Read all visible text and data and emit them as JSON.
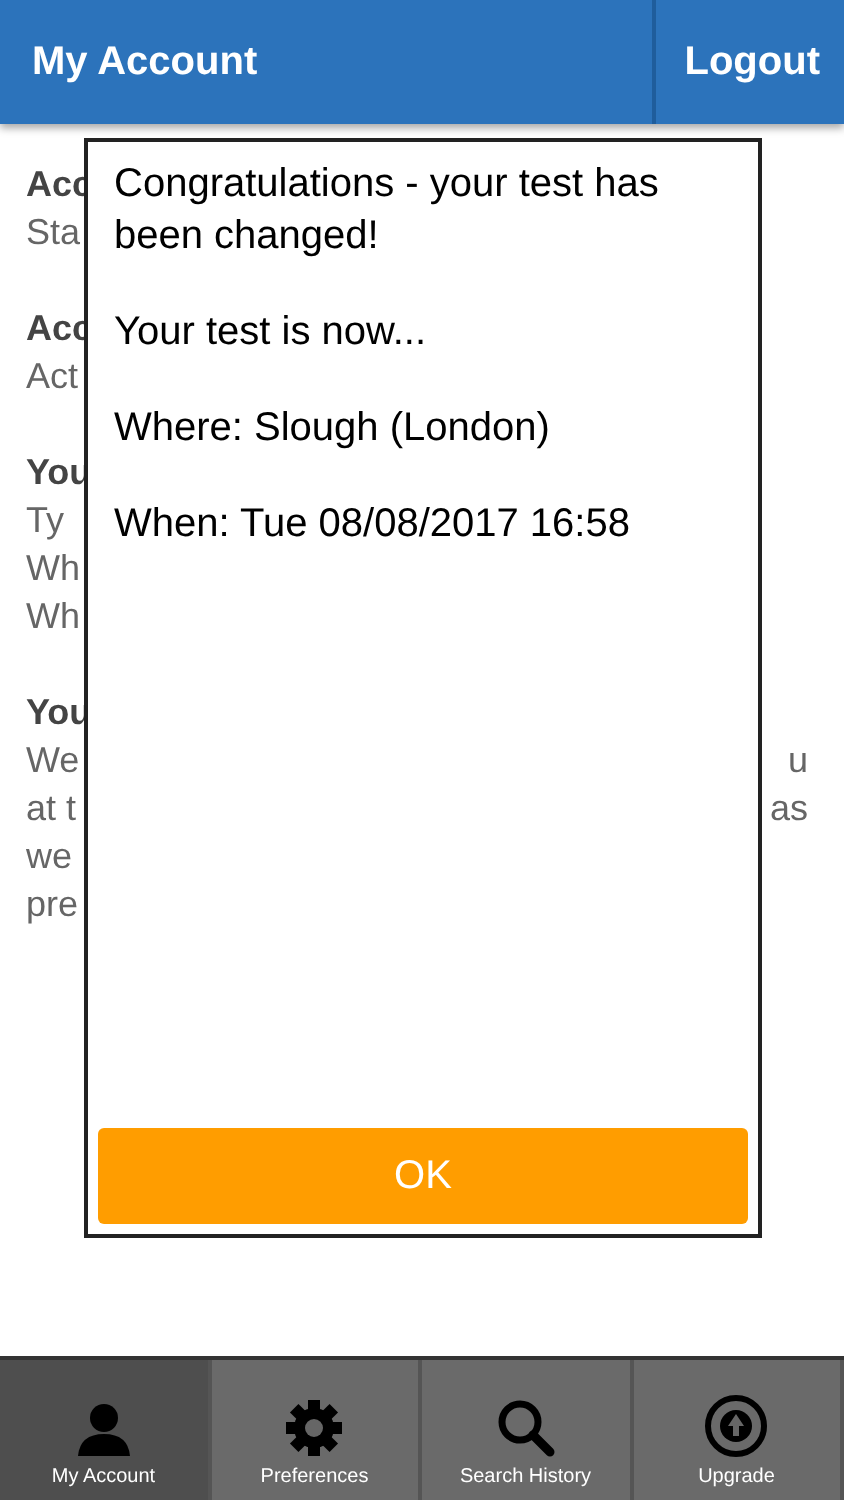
{
  "header": {
    "title": "My Account",
    "logout": "Logout"
  },
  "background_sections": [
    {
      "heading": "Acc",
      "lines": [
        {
          "left": "Sta"
        }
      ]
    },
    {
      "heading": "Acc",
      "lines": [
        {
          "left": "Act"
        }
      ]
    },
    {
      "heading": "You",
      "lines": [
        {
          "left": "Ty"
        },
        {
          "left": "Wh"
        },
        {
          "left": "Wh"
        }
      ]
    },
    {
      "heading": "You",
      "lines": [
        {
          "left": "We",
          "right": "u"
        },
        {
          "left": "at t",
          "right": "as"
        },
        {
          "left": "we"
        },
        {
          "left": "pre"
        }
      ]
    }
  ],
  "dialog": {
    "paragraphs": [
      "Congratulations - your test has been changed!",
      "Your test is now...",
      "Where: Slough (London)",
      "When: Tue 08/08/2017 16:58"
    ],
    "button": "OK"
  },
  "tabs": [
    {
      "label": "My Account",
      "kind": "account",
      "selected": true
    },
    {
      "label": "Preferences",
      "kind": "preferences",
      "selected": false
    },
    {
      "label": "Search History",
      "kind": "history",
      "selected": false
    },
    {
      "label": "Upgrade",
      "kind": "upgrade",
      "selected": false
    }
  ]
}
